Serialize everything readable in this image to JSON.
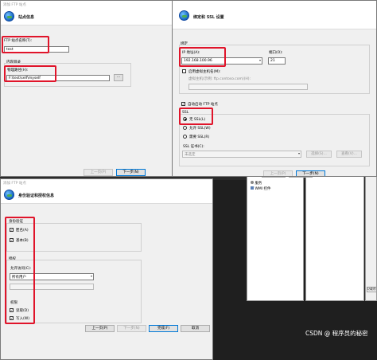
{
  "w1": {
    "title": "添加 FTP 站点",
    "header": "站点信息",
    "site_name_label": "FTP 站点名称(T):",
    "site_name_value": "test",
    "content_dir_label": "内容目录",
    "phys_path_label": "物理路径(H):",
    "phys_path_value": "F:\\test\\self\\myself",
    "browse_label": "...",
    "prev_label": "上一页(P)",
    "next_label": "下一步(N)"
  },
  "w2": {
    "header": "绑定和 SSL 设置",
    "binding_label": "绑定",
    "ip_label": "IP 地址(A):",
    "ip_value": "192.168.100.96",
    "port_label": "端口(O):",
    "port_value": "21",
    "vhost_label": "启用虚拟主机名(M):",
    "vhost_field_label": "虚拟主机(示例: ftp.contoso.com)(H):",
    "autostart_label": "自动启动 FTP 站点",
    "ssl_label": "SSL",
    "ssl_none": "无 SSL(L)",
    "ssl_allow": "允许 SSL(W)",
    "ssl_require": "需要 SSL(R)",
    "cert_label": "SSL 证书(C):",
    "cert_value": "未选定",
    "select_label": "选择(S)...",
    "view_label": "查看(V)...",
    "prev_label": "上一页(P)",
    "next_label": "下一步(N)"
  },
  "w3": {
    "title": "添加 FTP 站点",
    "header": "身份验证和授权信息",
    "auth_label": "身份验证",
    "anon_label": "匿名(A)",
    "basic_label": "基本(B)",
    "authz_label": "授权",
    "allow_label": "允许访问(C):",
    "allow_value": "所有用户",
    "perm_label": "权限",
    "read_label": "读取(D)",
    "write_label": "写入(W)",
    "prev_label": "上一页(P)",
    "next_label": "下一步(N)",
    "finish_label": "完成(F)",
    "cancel_label": "取消"
  },
  "bg": {
    "tree_item1": "服务",
    "tree_item2": "WMI 控件",
    "prev_label": "上一页(P)",
    "next_label": "下一步(N)",
    "side_item": "功能视",
    "watermark": "CSDN @ 程序员的秘密"
  }
}
